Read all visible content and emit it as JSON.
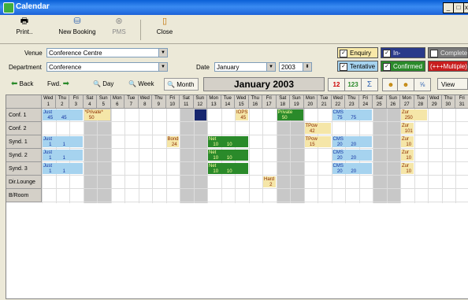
{
  "window": {
    "title": "Calendar"
  },
  "toolbar": {
    "print": "Print..",
    "new_booking": "New Booking",
    "pms": "PMS",
    "close": "Close"
  },
  "filters": {
    "venue_label": "Venue",
    "venue_value": "Conference Centre",
    "department_label": "Department",
    "department_value": "Conference",
    "date_label": "Date",
    "date_month": "January",
    "date_year": "2003"
  },
  "statuses": {
    "enquiry": "Enquiry",
    "in_progress": "In-Progress",
    "complete": "Complete",
    "tentative": "Tentative",
    "confirmed": "Confirmed",
    "multiple": "(+++Multiple)"
  },
  "nav": {
    "back": "Back",
    "fwd": "Fwd.",
    "day": "Day",
    "week": "Week",
    "month": "Month",
    "month_title": "January 2003",
    "view": "View",
    "icon1": "12",
    "icon2": "123",
    "icon3": "Σ",
    "icon4": "☻",
    "icon5": "☻",
    "icon6": "⅝"
  },
  "days": [
    {
      "d": "Wed",
      "n": "1"
    },
    {
      "d": "Thu",
      "n": "2"
    },
    {
      "d": "Fri",
      "n": "3"
    },
    {
      "d": "Sat",
      "n": "4"
    },
    {
      "d": "Sun",
      "n": "5"
    },
    {
      "d": "Mon",
      "n": "6"
    },
    {
      "d": "Tue",
      "n": "7"
    },
    {
      "d": "Wed",
      "n": "8"
    },
    {
      "d": "Thu",
      "n": "9"
    },
    {
      "d": "Fri",
      "n": "10"
    },
    {
      "d": "Sat",
      "n": "11"
    },
    {
      "d": "Sun",
      "n": "12"
    },
    {
      "d": "Mon",
      "n": "13"
    },
    {
      "d": "Tue",
      "n": "14"
    },
    {
      "d": "Wed",
      "n": "15"
    },
    {
      "d": "Thu",
      "n": "16"
    },
    {
      "d": "Fri",
      "n": "17"
    },
    {
      "d": "Sat",
      "n": "18"
    },
    {
      "d": "Sun",
      "n": "19"
    },
    {
      "d": "Mon",
      "n": "20"
    },
    {
      "d": "Tue",
      "n": "21"
    },
    {
      "d": "Wed",
      "n": "22"
    },
    {
      "d": "Thu",
      "n": "23"
    },
    {
      "d": "Fri",
      "n": "24"
    },
    {
      "d": "Sat",
      "n": "25"
    },
    {
      "d": "Sun",
      "n": "26"
    },
    {
      "d": "Mon",
      "n": "27"
    },
    {
      "d": "Tue",
      "n": "28"
    },
    {
      "d": "Wed",
      "n": "29"
    },
    {
      "d": "Thu",
      "n": "30"
    },
    {
      "d": "Fri",
      "n": "31"
    }
  ],
  "rooms": [
    "Conf. 1",
    "Conf. 2",
    "Synd. 1",
    "Synd. 2",
    "Synd. 3",
    "Dir.Lounge",
    "B/Room"
  ],
  "bookings": [
    {
      "row": 0,
      "start": 1,
      "span": 3,
      "color": "blue",
      "name": "Just",
      "nums": [
        "45",
        "45",
        "45"
      ]
    },
    {
      "row": 0,
      "start": 4,
      "span": 2,
      "color": "yel",
      "name": "*Private*",
      "nums": [
        "50"
      ]
    },
    {
      "row": 0,
      "start": 12,
      "span": 1,
      "color": "navy",
      "name": "",
      "nums": []
    },
    {
      "row": 0,
      "start": 15,
      "span": 1,
      "color": "yel",
      "name": "IOPS",
      "nums": [
        "45"
      ]
    },
    {
      "row": 0,
      "start": 18,
      "span": 2,
      "color": "grn",
      "name": "Private",
      "nums": [
        "50"
      ]
    },
    {
      "row": 0,
      "start": 22,
      "span": 3,
      "color": "blue",
      "name": "CMS",
      "nums": [
        "75",
        "75",
        "75"
      ]
    },
    {
      "row": 0,
      "start": 27,
      "span": 2,
      "color": "yel",
      "name": "Zur",
      "nums": [
        "250",
        "250"
      ]
    },
    {
      "row": 1,
      "start": 20,
      "span": 2,
      "color": "yel",
      "name": "TPow",
      "nums": [
        "42",
        "42"
      ]
    },
    {
      "row": 1,
      "start": 27,
      "span": 1,
      "color": "yel",
      "name": "Zur",
      "nums": [
        "101",
        "101"
      ]
    },
    {
      "row": 2,
      "start": 1,
      "span": 3,
      "color": "blue",
      "name": "Just",
      "nums": [
        "1",
        "1",
        "1"
      ]
    },
    {
      "row": 2,
      "start": 10,
      "span": 1,
      "color": "yel",
      "name": "Bonds",
      "nums": [
        "24"
      ]
    },
    {
      "row": 2,
      "start": 13,
      "span": 3,
      "color": "grn",
      "name": "Net",
      "nums": [
        "10",
        "10",
        "10"
      ]
    },
    {
      "row": 2,
      "start": 20,
      "span": 2,
      "color": "yel",
      "name": "TPow",
      "nums": [
        "15",
        "15"
      ]
    },
    {
      "row": 2,
      "start": 22,
      "span": 3,
      "color": "blue",
      "name": "CMS",
      "nums": [
        "20",
        "20",
        "20"
      ]
    },
    {
      "row": 2,
      "start": 27,
      "span": 1,
      "color": "yel",
      "name": "Zur",
      "nums": [
        "10",
        "10"
      ]
    },
    {
      "row": 3,
      "start": 1,
      "span": 3,
      "color": "blue",
      "name": "Just",
      "nums": [
        "1",
        "1",
        "1"
      ]
    },
    {
      "row": 3,
      "start": 13,
      "span": 3,
      "color": "grn",
      "name": "Net",
      "nums": [
        "10",
        "10",
        "10"
      ]
    },
    {
      "row": 3,
      "start": 22,
      "span": 3,
      "color": "blue",
      "name": "CMS",
      "nums": [
        "20",
        "20",
        "20"
      ]
    },
    {
      "row": 3,
      "start": 27,
      "span": 1,
      "color": "yel",
      "name": "Zur",
      "nums": [
        "10",
        "10"
      ]
    },
    {
      "row": 4,
      "start": 1,
      "span": 3,
      "color": "blue",
      "name": "Just",
      "nums": [
        "1",
        "1",
        "1"
      ]
    },
    {
      "row": 4,
      "start": 13,
      "span": 3,
      "color": "grn",
      "name": "Net",
      "nums": [
        "10",
        "10",
        "10"
      ]
    },
    {
      "row": 4,
      "start": 22,
      "span": 3,
      "color": "blue",
      "name": "CMS",
      "nums": [
        "20",
        "20",
        "20"
      ]
    },
    {
      "row": 4,
      "start": 27,
      "span": 1,
      "color": "yel",
      "name": "Zur",
      "nums": [
        "10",
        "10"
      ]
    },
    {
      "row": 5,
      "start": 17,
      "span": 1,
      "color": "yel",
      "name": "Hard",
      "nums": [
        "2"
      ]
    }
  ]
}
